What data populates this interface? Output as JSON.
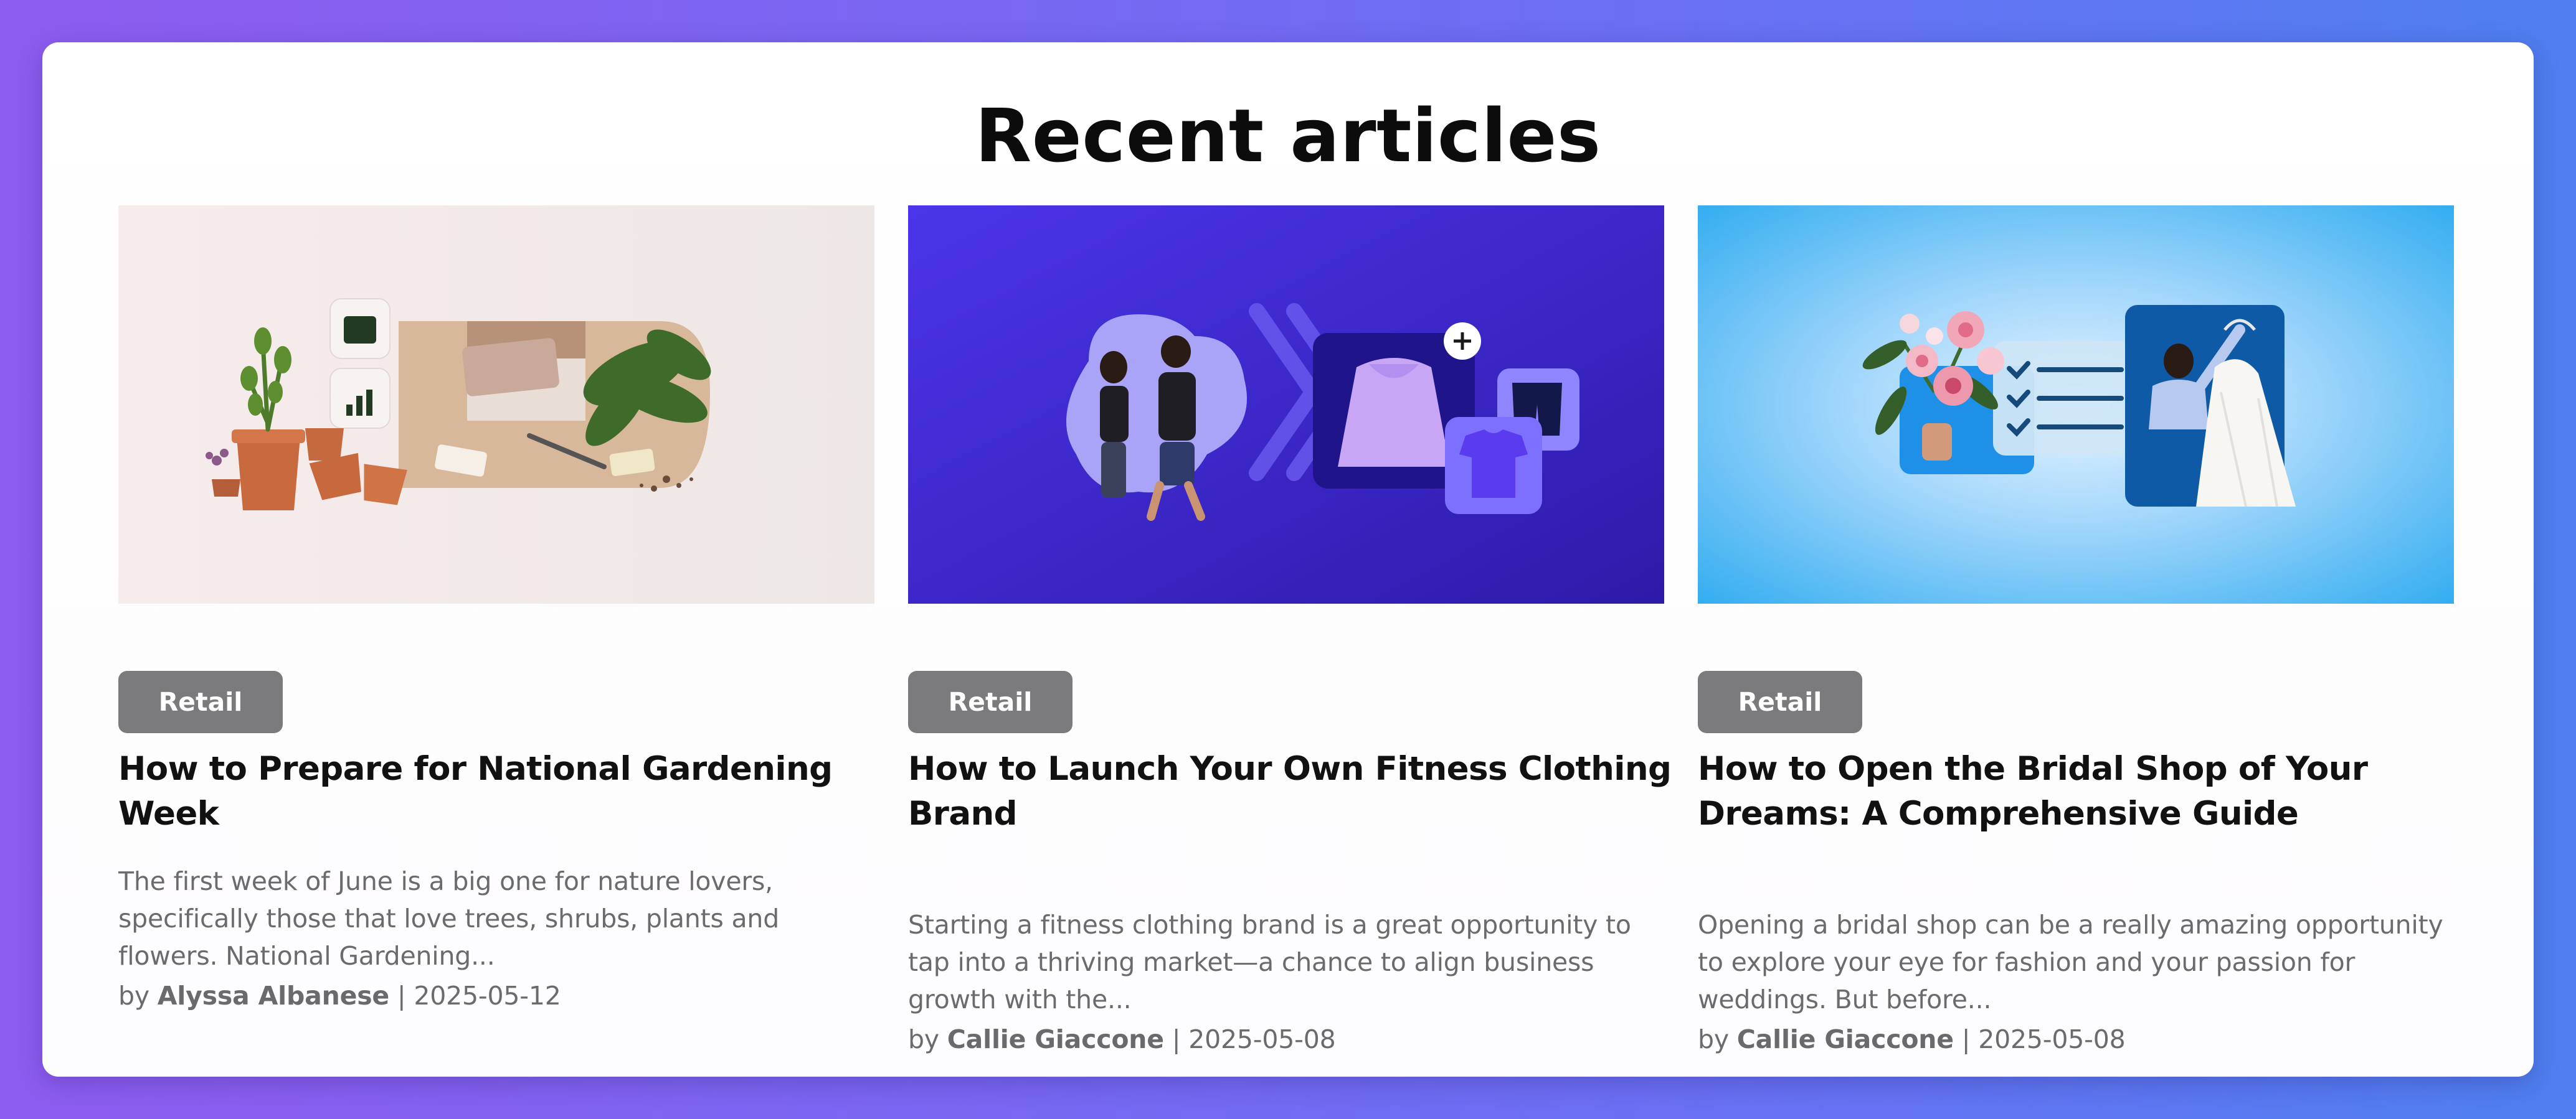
{
  "section": {
    "title": "Recent articles"
  },
  "articles": [
    {
      "category": "Retail",
      "title": "How to Prepare for National Gardening Week",
      "excerpt": "The first week of June is a big one for nature lovers, specifically those that love trees, shrubs, plants and flowers. National Gardening...",
      "by": "by",
      "author": "Alyssa Albanese",
      "date": "2025-05-12",
      "image_icon": "gardening-illustration"
    },
    {
      "category": "Retail",
      "title": "How to Launch Your Own Fitness Clothing Brand",
      "excerpt": "Starting a fitness clothing brand is a great opportunity to tap into a thriving market—a chance to align business growth with the...",
      "by": "by",
      "author": "Callie Giaccone",
      "date": "2025-05-08",
      "image_icon": "fitness-clothing-illustration"
    },
    {
      "category": "Retail",
      "title": "How to Open the Bridal Shop of Your Dreams: A Comprehensive Guide",
      "excerpt": "Opening a bridal shop can be a really amazing opportunity to explore your eye for fashion and your passion for weddings. But before...",
      "by": "by",
      "author": "Callie Giaccone",
      "date": "2025-05-08",
      "image_icon": "bridal-shop-illustration"
    }
  ],
  "colors": {
    "background_start": "#8e5cf0",
    "background_end": "#4f7ff0",
    "tag_background": "#7b7a7d",
    "gardening_bg": "#efe9e7",
    "fitness_bg": "#4231e0",
    "bridal_bg": "#49b7f2"
  }
}
